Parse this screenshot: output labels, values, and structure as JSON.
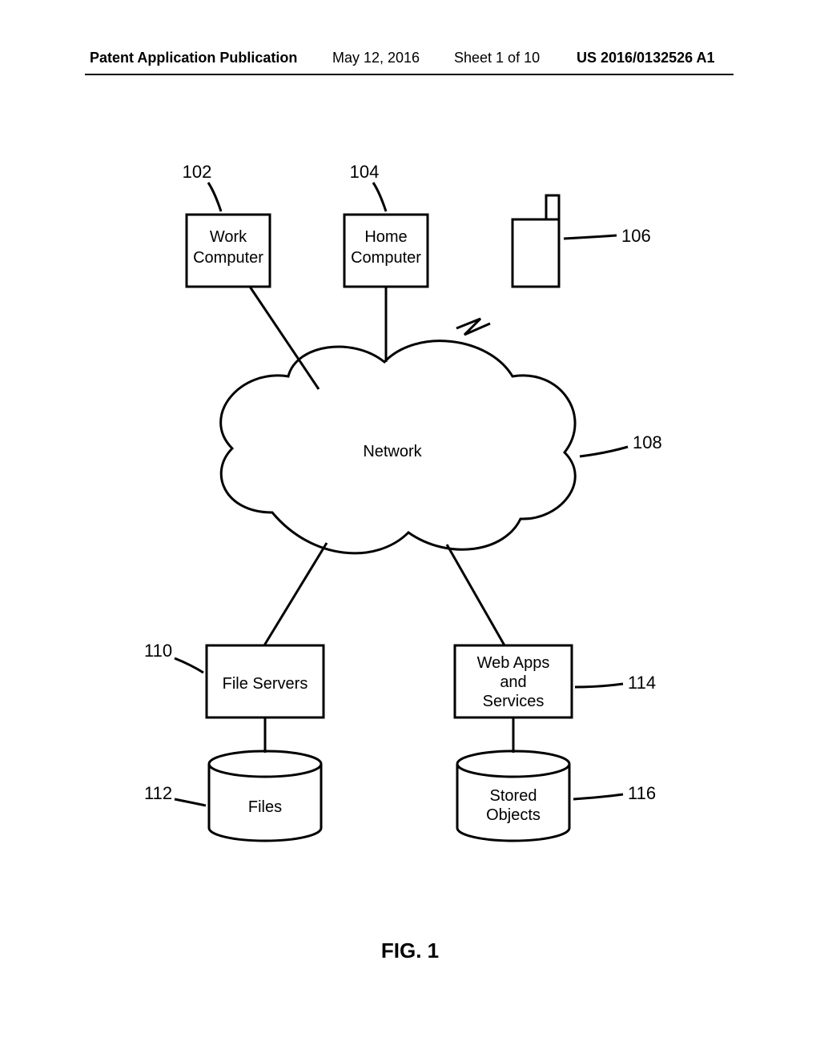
{
  "header": {
    "publication": "Patent Application Publication",
    "date": "May 12, 2016",
    "sheet": "Sheet 1 of 10",
    "docnum": "US 2016/0132526 A1"
  },
  "figure": {
    "caption": "FIG. 1",
    "nodes": {
      "work_computer": {
        "label_l1": "Work",
        "label_l2": "Computer",
        "ref": "102"
      },
      "home_computer": {
        "label_l1": "Home",
        "label_l2": "Computer",
        "ref": "104"
      },
      "mobile": {
        "ref": "106"
      },
      "network": {
        "label": "Network",
        "ref": "108"
      },
      "file_servers": {
        "label": "File Servers",
        "ref": "110"
      },
      "files": {
        "label": "Files",
        "ref": "112"
      },
      "web_apps": {
        "label_l1": "Web Apps",
        "label_l2": "and",
        "label_l3": "Services",
        "ref": "114"
      },
      "stored_objects": {
        "label_l1": "Stored",
        "label_l2": "Objects",
        "ref": "116"
      }
    }
  }
}
